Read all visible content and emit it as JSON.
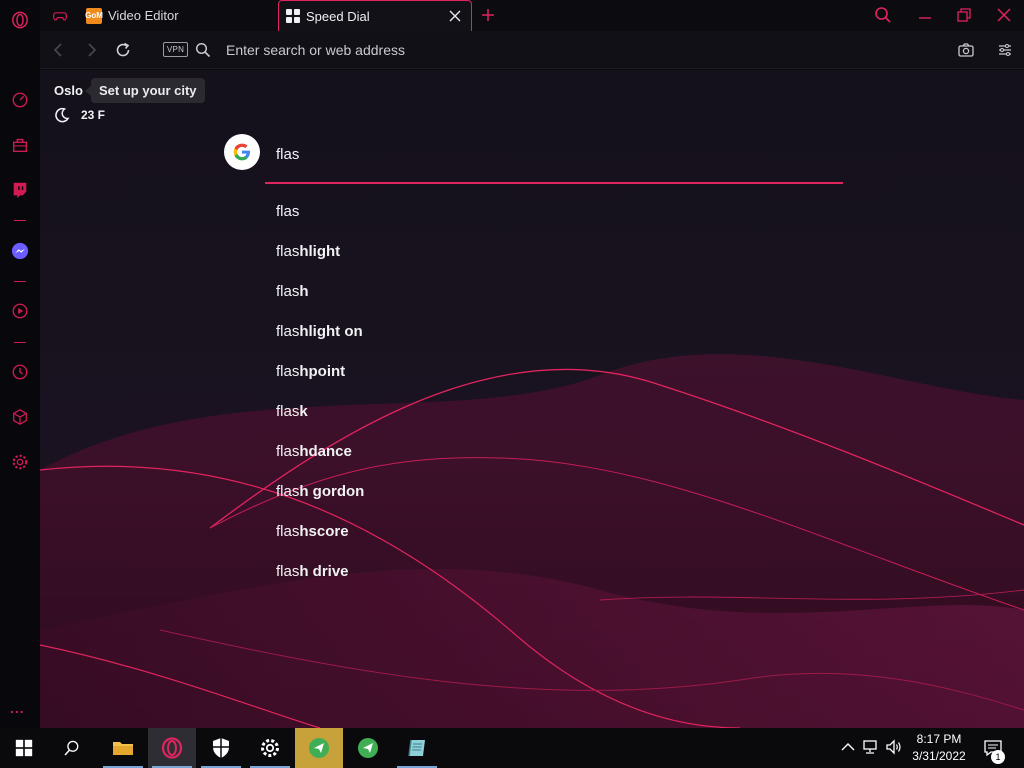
{
  "tabs": [
    {
      "label": "Video Editor",
      "icon": "gom-app-icon",
      "active": false
    },
    {
      "label": "Speed Dial",
      "icon": "grid-icon",
      "active": true
    }
  ],
  "app_icon_text": "GoM",
  "address_bar": {
    "vpn_label": "VPN",
    "placeholder": "Enter search or web address"
  },
  "weather": {
    "city": "Oslo",
    "tooltip": "Set up your city",
    "temperature": "23 F"
  },
  "search": {
    "engine": "Google",
    "query": "flas"
  },
  "suggestions": [
    {
      "typed": "flas",
      "rest": ""
    },
    {
      "typed": "flas",
      "rest": "hlight"
    },
    {
      "typed": "flas",
      "rest": "h"
    },
    {
      "typed": "flas",
      "rest": "hlight on"
    },
    {
      "typed": "flas",
      "rest": "hpoint"
    },
    {
      "typed": "flas",
      "rest": "k"
    },
    {
      "typed": "flas",
      "rest": "hdance"
    },
    {
      "typed": "flas",
      "rest": "h gordon"
    },
    {
      "typed": "flas",
      "rest": "hscore"
    },
    {
      "typed": "flas",
      "rest": "h drive"
    }
  ],
  "sidebar_items": [
    "opera-logo-icon",
    "speed-dial-icon",
    "bag-icon",
    "twitch-icon",
    "messenger-icon",
    "player-icon",
    "history-icon",
    "cube-icon",
    "settings-icon",
    "more-icon"
  ],
  "sidebar_more": "...",
  "taskbar": {
    "time": "8:17 PM",
    "date": "3/31/2022",
    "notification_count": "1"
  },
  "colors": {
    "accent": "#e0245e",
    "background": "#14111b",
    "taskbar": "#0a0a0d"
  }
}
